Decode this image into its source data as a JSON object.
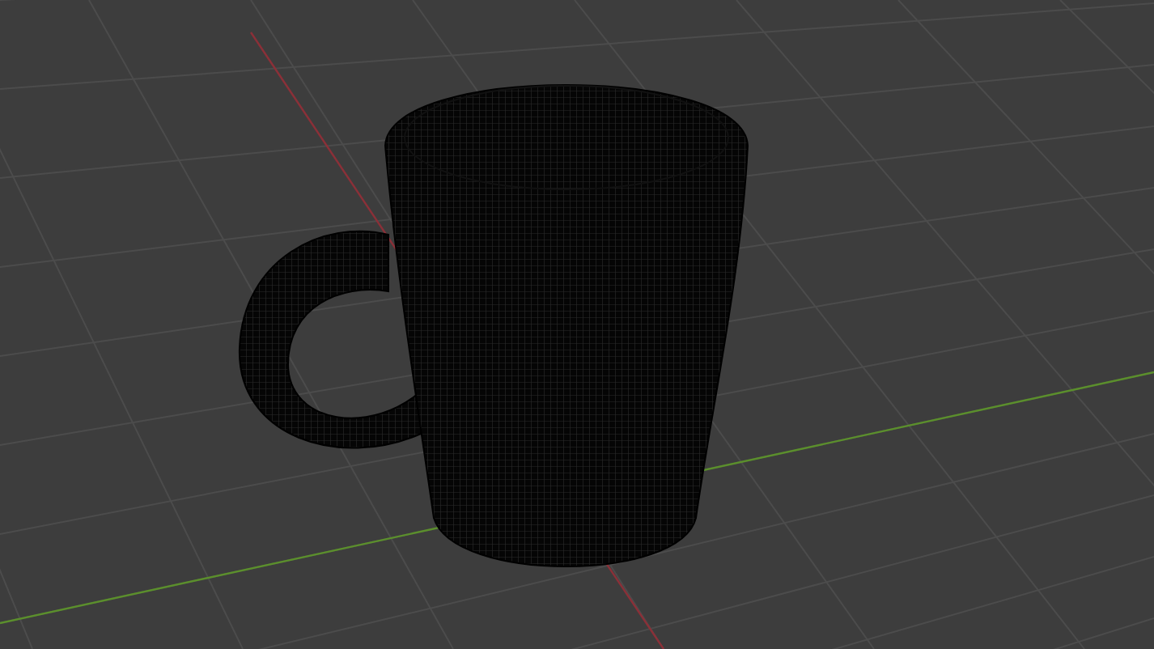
{
  "viewport": {
    "axes": [
      {
        "kind": "x",
        "color": "#8b3038"
      },
      {
        "kind": "y",
        "color": "#5b8f2c"
      }
    ]
  }
}
